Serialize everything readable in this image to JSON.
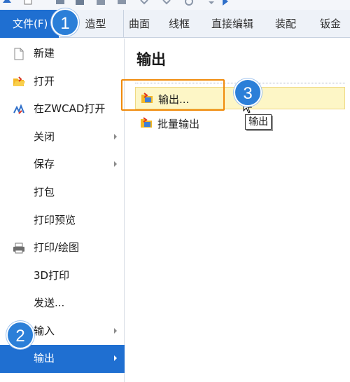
{
  "tabs": {
    "file": "文件(F)",
    "model": "造型",
    "surface": "曲面",
    "wireframe": "线框",
    "direct_edit": "直接编辑",
    "assembly": "装配",
    "sheet_metal": "钣金"
  },
  "file_menu": {
    "items": [
      {
        "label": "新建",
        "icon": "new-file-icon"
      },
      {
        "label": "打开",
        "icon": "open-folder-icon"
      },
      {
        "label": "在ZWCAD打开",
        "icon": "zwcad-icon"
      },
      {
        "label": "关闭"
      },
      {
        "label": "保存"
      },
      {
        "label": "打包"
      },
      {
        "label": "打印预览"
      },
      {
        "label": "打印/绘图",
        "icon": "printer-icon"
      },
      {
        "label": "3D打印"
      },
      {
        "label": "发送..."
      },
      {
        "label": "输入"
      },
      {
        "label": "输出"
      }
    ],
    "selected": "输出"
  },
  "panel": {
    "title": "输出",
    "export_label": "输出...",
    "batch_label": "批量输出"
  },
  "tooltip": "输出",
  "badges": [
    "1",
    "2",
    "3"
  ],
  "colors": {
    "accent": "#1f6fd1",
    "highlight_box": "#f08a0a",
    "hover_bg": "#fdf6c6",
    "badge": "#2b7fd8"
  }
}
